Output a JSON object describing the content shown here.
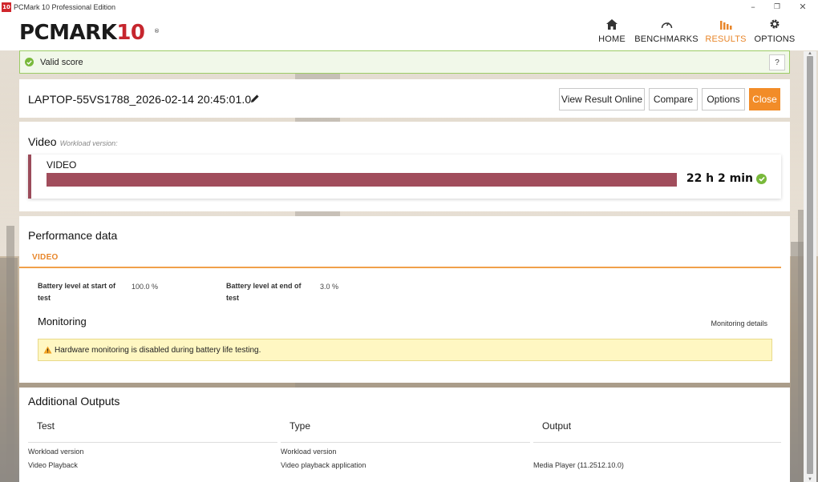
{
  "window": {
    "title": "PCMark 10 Professional Edition",
    "app_icon_text": "10"
  },
  "header": {
    "logo": "PCMARK",
    "logo_number": "10",
    "nav": [
      {
        "label": "HOME",
        "icon": "home-icon",
        "active": false
      },
      {
        "label": "BENCHMARKS",
        "icon": "gauge-icon",
        "active": false
      },
      {
        "label": "RESULTS",
        "icon": "bar-chart-icon",
        "active": true
      },
      {
        "label": "OPTIONS",
        "icon": "gear-icon",
        "active": false
      }
    ]
  },
  "valid_score": {
    "text": "Valid score",
    "help": "?"
  },
  "result": {
    "title": "LAPTOP-55VS1788_2026-02-14 20:45:01.0",
    "buttons": {
      "view_online": "View Result Online",
      "compare": "Compare",
      "options": "Options",
      "close": "Close"
    }
  },
  "video": {
    "title": "Video",
    "subtitle": "Workload version:",
    "card_label": "VIDEO",
    "score": "22 h 2 min"
  },
  "performance": {
    "title": "Performance data",
    "tab": "VIDEO",
    "battery_start_label": "Battery level at start of test",
    "battery_start_value": "100.0 %",
    "battery_end_label": "Battery level at end of test",
    "battery_end_value": "3.0 %",
    "monitoring_title": "Monitoring",
    "monitoring_link": "Monitoring details",
    "warning": "Hardware monitoring is disabled during battery life testing."
  },
  "outputs": {
    "title": "Additional Outputs",
    "columns": [
      "Test",
      "Type",
      "Output"
    ],
    "rows": [
      [
        "Workload version",
        "Workload version",
        ""
      ],
      [
        "Video Playback",
        "Video playback application",
        "Media Player (11.2512.10.0)"
      ]
    ]
  },
  "colors": {
    "accent": "#e8862a",
    "score_bar": "#a14d5c",
    "valid_green": "#79b93b",
    "warning_bg": "#fff7c2"
  }
}
